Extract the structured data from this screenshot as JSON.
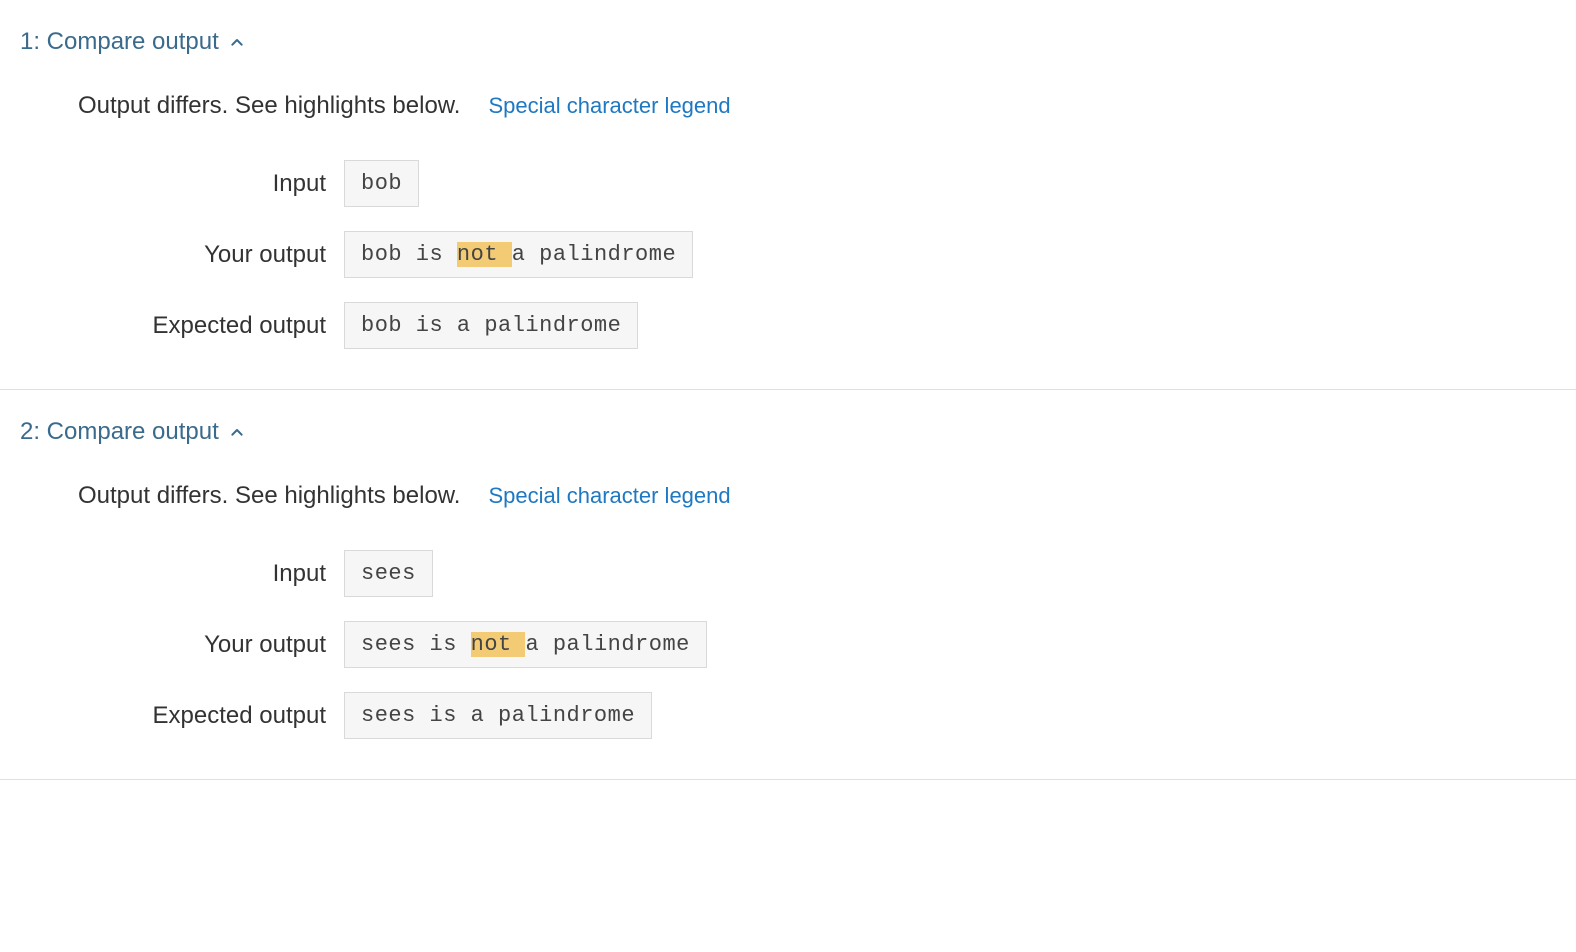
{
  "legend_link": "Special character legend",
  "labels": {
    "input": "Input",
    "your_output": "Your output",
    "expected_output": "Expected output"
  },
  "tests": [
    {
      "title": "1: Compare output",
      "message": "Output differs. See highlights below.",
      "input": "bob",
      "your_output_segments": [
        {
          "text": "bob is ",
          "highlight": false
        },
        {
          "text": "not ",
          "highlight": true
        },
        {
          "text": "a palindrome",
          "highlight": false
        }
      ],
      "expected_output": "bob is a palindrome"
    },
    {
      "title": "2: Compare output",
      "message": "Output differs. See highlights below.",
      "input": "sees",
      "your_output_segments": [
        {
          "text": "sees is ",
          "highlight": false
        },
        {
          "text": "not ",
          "highlight": true
        },
        {
          "text": "a palindrome",
          "highlight": false
        }
      ],
      "expected_output": "sees is a palindrome"
    }
  ]
}
